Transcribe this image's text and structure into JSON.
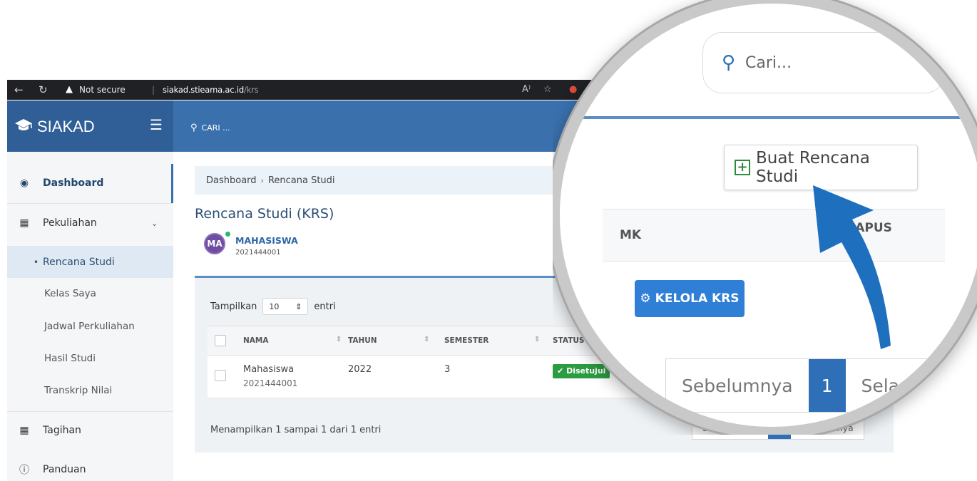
{
  "browser": {
    "security_label": "Not secure",
    "url_host": "siakad.stieama.ac.id",
    "url_path": "/krs"
  },
  "header": {
    "brand": "SIAKAD",
    "search_label": "CARI ..."
  },
  "sidebar": {
    "items": [
      {
        "label": "Dashboard",
        "icon": "dashboard-icon"
      },
      {
        "label": "Pekuliahan",
        "icon": "book-icon"
      },
      {
        "label": "Rencana Studi"
      },
      {
        "label": "Kelas Saya"
      },
      {
        "label": "Jadwal Perkuliahan"
      },
      {
        "label": "Hasil Studi"
      },
      {
        "label": "Transkrip Nilai"
      },
      {
        "label": "Tagihan",
        "icon": "calendar-icon"
      },
      {
        "label": "Panduan",
        "icon": "help-icon"
      }
    ]
  },
  "main": {
    "breadcrumb": [
      "Dashboard",
      "Rencana Studi"
    ],
    "title": "Rencana Studi (KRS)",
    "user": {
      "initials": "MA",
      "name": "MAHASISWA",
      "nim": "2021444001"
    },
    "entries": {
      "prefix": "Tampilkan",
      "value": "10",
      "suffix": "entri"
    },
    "table": {
      "headers": [
        "NAMA",
        "TAHUN",
        "SEMESTER",
        "STATUS"
      ],
      "rows": [
        {
          "nama": "Mahasiswa",
          "nim": "2021444001",
          "tahun": "2022",
          "semester": "3",
          "status": "Disetujui"
        }
      ]
    },
    "footer_info": "Menampilkan 1 sampai 1 dari 1 entri",
    "pager": {
      "prev": "Sebelumnya",
      "current": "1",
      "next": "Selanjutnya"
    }
  },
  "magnifier": {
    "search_placeholder": "Cari...",
    "create_button": "Buat Rencana Studi",
    "col_mk": "MK",
    "col_hapus": "HAPUS",
    "kelola_button": "KELOLA KRS",
    "pager_prev": "Sebelumnya",
    "pager_current": "1",
    "pager_next": "Selanjutnya"
  },
  "colors": {
    "brand": "#2f5f96",
    "topbar": "#3a71ad",
    "accent": "#2f6fb8",
    "success": "#2b9c3f",
    "arrow": "#1f6fbf"
  }
}
